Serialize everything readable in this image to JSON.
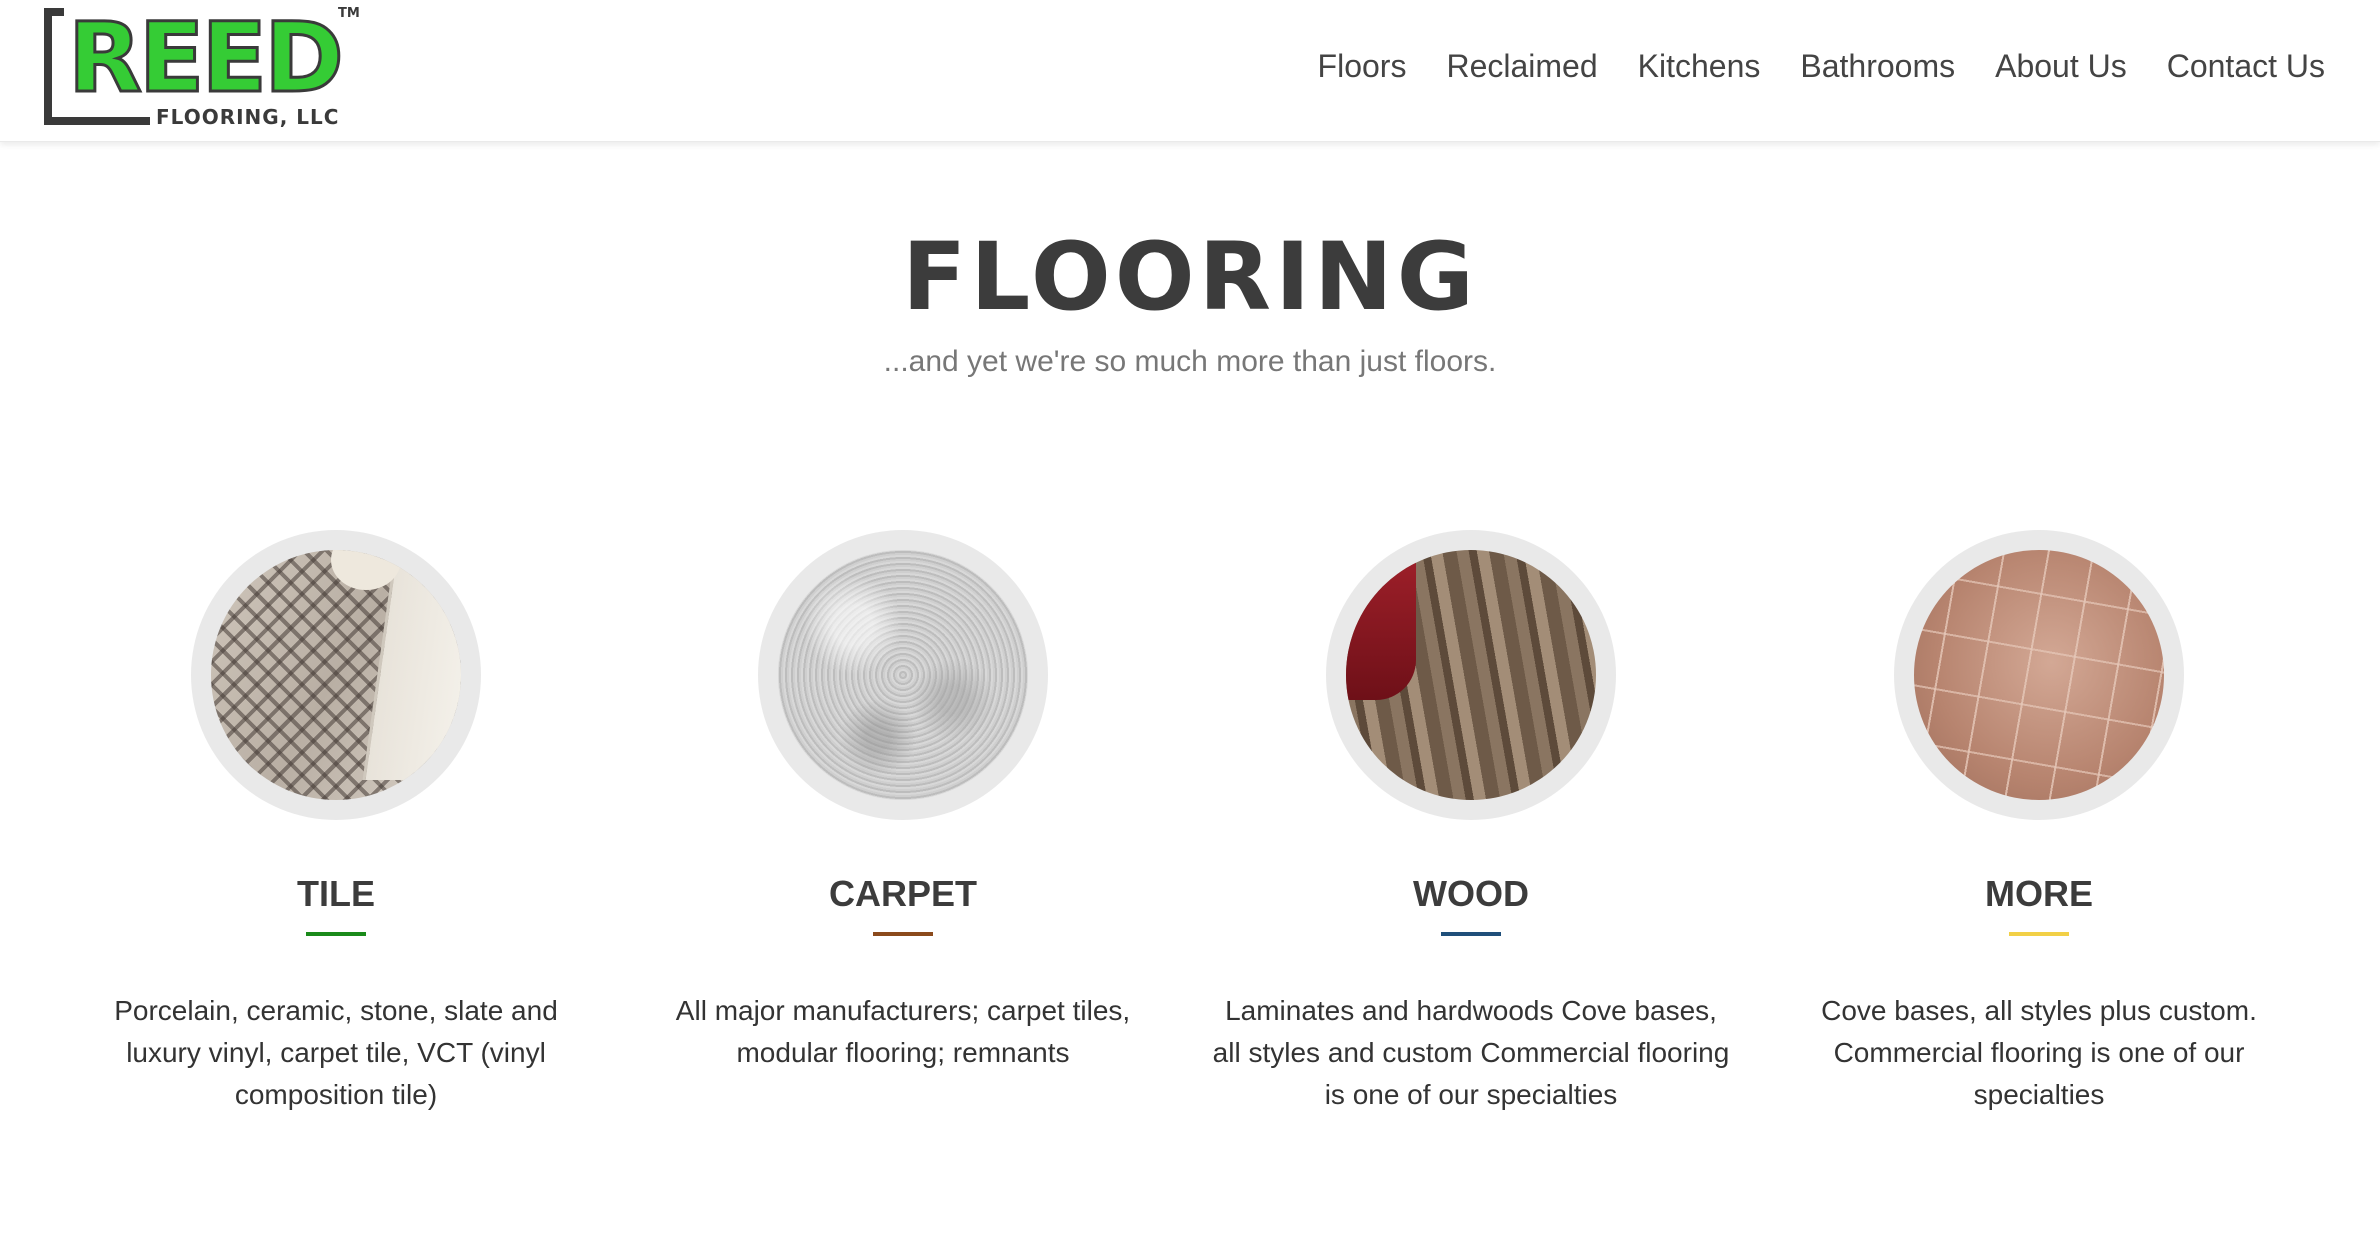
{
  "header": {
    "logo": {
      "word": "REED",
      "sub": "FLOORING, LLC",
      "tm": "TM"
    },
    "nav": [
      "Floors",
      "Reclaimed",
      "Kitchens",
      "Bathrooms",
      "About Us",
      "Contact Us"
    ]
  },
  "hero": {
    "title": "FLOORING",
    "subtitle": "...and yet we're so much more than just floors."
  },
  "cards": [
    {
      "title": "TILE",
      "accent": "#1a8a1a",
      "description": "Porcelain, ceramic, stone, slate and luxury vinyl, carpet tile, VCT (vinyl composition tile)"
    },
    {
      "title": "CARPET",
      "accent": "#8b4a1c",
      "description": "All major manufacturers; carpet tiles, modular flooring; remnants"
    },
    {
      "title": "WOOD",
      "accent": "#1f4f7a",
      "description": "Laminates and hardwoods Cove bases, all styles and custom Commercial flooring is one of our specialties"
    },
    {
      "title": "MORE",
      "accent": "#f2d046",
      "description": "Cove bases, all styles plus custom. Commercial flooring is one of our specialties"
    }
  ]
}
